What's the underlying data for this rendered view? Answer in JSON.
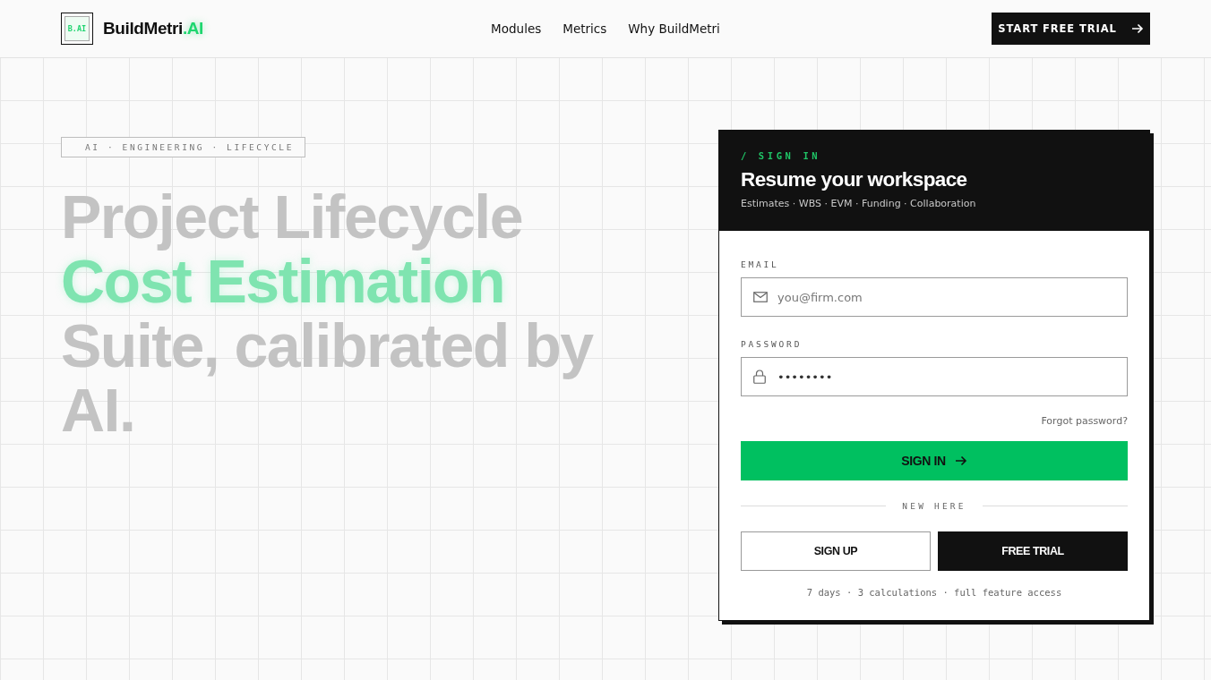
{
  "header": {
    "logo_mark": "B.AI",
    "brand": {
      "name": "BuildMetri",
      "suffix": ".AI"
    },
    "nav": [
      "Modules",
      "Metrics",
      "Why BuildMetri"
    ],
    "cta": "START FREE TRIAL"
  },
  "hero": {
    "tag": "AI · ENGINEERING · LIFECYCLE",
    "headline": [
      {
        "text": "Project Lifecycle",
        "accent": false
      },
      {
        "text": "Cost Estimation",
        "accent": true
      },
      {
        "text": "Suite, calibrated by AI.",
        "accent": false
      }
    ]
  },
  "signin": {
    "eyebrow": "/ SIGN IN",
    "title": "Resume your workspace",
    "subtitle": "Estimates · WBS · EVM · Funding · Collaboration",
    "fields": [
      {
        "kind": "email",
        "label": "EMAIL",
        "placeholder": "you@firm.com"
      },
      {
        "kind": "password",
        "label": "PASSWORD",
        "value": "••••••••"
      }
    ],
    "forgot": "Forgot password?",
    "submit": "SIGN IN",
    "divider": "NEW HERE",
    "secondary": [
      {
        "label": "SIGN UP",
        "kind": "outline"
      },
      {
        "label": "FREE TRIAL",
        "kind": "solid"
      }
    ],
    "note": "7 days · 3 calculations · full feature access"
  }
}
